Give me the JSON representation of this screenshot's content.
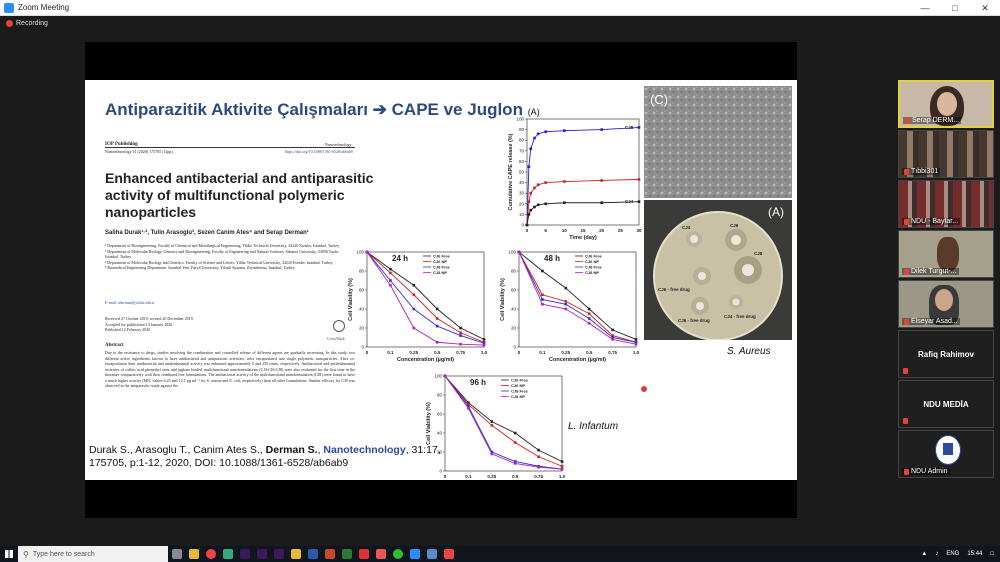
{
  "window": {
    "title": "Zoom Meeting"
  },
  "recording": {
    "label": "Recording"
  },
  "slide": {
    "title": "Antiparazitik Aktivite Çalışmaları ➔ CAPE ve Juglon",
    "title_marker": "(A)",
    "publisher": "IOP Publishing",
    "journal_right": "Nanotechnology",
    "journal_line": "Nanotechnology 31 (2020) 175705 (12pp)",
    "doi_line": "https://doi.org/10.1088/1361-6528/ab6ab9",
    "paper_title": "Enhanced antibacterial and antiparasitic activity of multifunctional polymeric nanoparticles",
    "authors": "Saliha Durak¹·², Tulin Arasoglu³, Sezen Canim Ates⁴ and Serap Derman¹",
    "affiliations": [
      "¹ Department of Bioengineering, Faculty of Chemical and Metallurgical Engineering, Yildiz Technical University, 34220 Esenler, Istanbul, Turkey",
      "² Department of Molecular Biology, Genetics and Bioengineering, Faculty of Engineering and Natural Sciences, Sabanci University, 34956 Tuzla, Istanbul, Turkey",
      "³ Department of Molecular Biology and Genetics, Faculty of Science and Letters, Yildiz Technical University, 34220 Esenler, Istanbul, Turkey",
      "⁴ Biomedical Engineering Department, Istanbul Yeni Yuzyil University, Yilanli Ayazma, Zeytinburnu, Istanbul, Turkey"
    ],
    "email": "E-mail: sderman@yildiz.edu.tr",
    "dates": [
      "Received 27 October 2019, revised 20 December 2019",
      "Accepted for publication 13 January 2020",
      "Published 12 February 2020"
    ],
    "crossmark": "CrossMark",
    "abstract_head": "Abstract",
    "abstract": "Due to the resistance to drugs, studies involving the combination and controlled release of different agents are gradually increasing. In this study, two different active ingredients, known to have antibacterial and antiparasitic activities, were encapsulated into single polymeric nanoparticles. After co-encapsulation their antibacterial and antileishmanial activity was enhanced approximately 5 and 250 times, respectively. Antibacterial and antileishmanial activities of caffeic acid phenethyl ester and juglone loaded, multifunctional nanoformulations (CJ4-CJ6-CJ8) were also evaluated for the first time in the literature comparatively with their combined free formulations. The antibacterial activity of the multifunctional nanoformulation (CJ8) were found to have a much higher activity (MIC values 6.25 and 12.5 µg ml⁻¹ for S. aureus and E. coli, respectively) than all other formulations. Similar efficacy for CJ8 was observed in the antiparasitic study against the",
    "citation": {
      "pre": "Durak S., Arasoglu T., Canim Ates S., ",
      "bold": "Derman S.",
      "mid": ", ",
      "journal": "Nanotechnology",
      "post": ", 31:17, 175705, p:1-12, 2020, DOI: 10.1088/1361-6528/ab6ab9"
    },
    "label_c": "(C)",
    "label_a": "(A)",
    "s_aureus": "S. Aureus",
    "l_infantum": "L. Infantum",
    "plate_labels": [
      {
        "text": "CJ4"
      },
      {
        "text": "CJ6"
      },
      {
        "text": "CJ8"
      },
      {
        "text": "CJ6 - free drug"
      },
      {
        "text": "CJ6 - free drug"
      },
      {
        "text": "CJ4 - free drug"
      }
    ]
  },
  "chart_data": [
    {
      "type": "line",
      "title": "",
      "xlabel": "Time (day)",
      "ylabel": "Cumulative CAPE release (%)",
      "x": [
        0,
        0.5,
        1,
        2,
        3,
        5,
        10,
        20,
        30
      ],
      "xticks": [
        0,
        5,
        10,
        15,
        20,
        25,
        30
      ],
      "yticks": [
        0,
        10,
        20,
        30,
        40,
        50,
        60,
        70,
        80,
        90,
        100
      ],
      "xlim": [
        0,
        30
      ],
      "ylim": [
        0,
        100
      ],
      "series": [
        {
          "name": "CJ8",
          "color": "#2020d0",
          "values": [
            0,
            55,
            72,
            82,
            86,
            88,
            89,
            90,
            92
          ]
        },
        {
          "name": "",
          "color": "#d02020",
          "values": [
            0,
            22,
            30,
            35,
            38,
            40,
            41,
            42,
            43
          ]
        },
        {
          "name": "CJ4",
          "color": "#202020",
          "values": [
            0,
            10,
            14,
            17,
            19,
            20,
            21,
            21,
            22
          ]
        }
      ]
    },
    {
      "type": "line",
      "title": "24 h",
      "xlabel": "Concentration (µg/ml)",
      "ylabel": "Cell Viability (%)",
      "categories": [
        "0",
        "0.1",
        "0.25",
        "0.5",
        "0.75",
        "1.0"
      ],
      "ylim": [
        0,
        100
      ],
      "yticks": [
        0,
        20,
        40,
        60,
        80,
        100
      ],
      "series": [
        {
          "name": "CJ6 Free",
          "color": "#222222",
          "values": [
            100,
            82,
            65,
            40,
            20,
            8
          ]
        },
        {
          "name": "CJ6 NP",
          "color": "#d02020",
          "values": [
            100,
            78,
            55,
            30,
            15,
            5
          ]
        },
        {
          "name": "CJ8 Free",
          "color": "#3030d0",
          "values": [
            100,
            70,
            40,
            22,
            12,
            4
          ]
        },
        {
          "name": "CJ8 NP",
          "color": "#b020c0",
          "values": [
            100,
            65,
            20,
            5,
            3,
            2
          ]
        }
      ]
    },
    {
      "type": "line",
      "title": "48 h",
      "xlabel": "Concentration (µg/ml)",
      "ylabel": "Cell Viability (%)",
      "categories": [
        "0",
        "0.1",
        "0.25",
        "0.5",
        "0.75",
        "1.0"
      ],
      "ylim": [
        0,
        100
      ],
      "yticks": [
        0,
        20,
        40,
        60,
        80,
        100
      ],
      "series": [
        {
          "name": "CJ6 Free",
          "color": "#222222",
          "values": [
            100,
            80,
            62,
            40,
            18,
            8
          ]
        },
        {
          "name": "CJ6 NP",
          "color": "#d02020",
          "values": [
            100,
            55,
            48,
            35,
            12,
            5
          ]
        },
        {
          "name": "CJ8 Free",
          "color": "#3030d0",
          "values": [
            100,
            50,
            45,
            30,
            10,
            5
          ]
        },
        {
          "name": "CJ8 NP",
          "color": "#b020c0",
          "values": [
            100,
            45,
            40,
            25,
            8,
            3
          ]
        }
      ]
    },
    {
      "type": "line",
      "title": "96 h",
      "xlabel": "Concentration (µg/ml)",
      "ylabel": "Cell Viability (%)",
      "categories": [
        "0",
        "0.1",
        "0.25",
        "0.5",
        "0.75",
        "1.0"
      ],
      "ylim": [
        0,
        100
      ],
      "yticks": [
        0,
        20,
        40,
        60,
        80,
        100
      ],
      "series": [
        {
          "name": "CJ6 Free",
          "color": "#222222",
          "values": [
            100,
            72,
            52,
            40,
            22,
            10
          ]
        },
        {
          "name": "CJ6 NP",
          "color": "#d02020",
          "values": [
            100,
            70,
            48,
            30,
            15,
            5
          ]
        },
        {
          "name": "CJ8 Free",
          "color": "#3030d0",
          "values": [
            100,
            68,
            20,
            10,
            5,
            2
          ]
        },
        {
          "name": "CJ8 NP",
          "color": "#b020c0",
          "values": [
            100,
            66,
            18,
            8,
            4,
            2
          ]
        }
      ]
    }
  ],
  "participants": [
    {
      "name": "Serap DERM..."
    },
    {
      "name": "Tıbbi301"
    },
    {
      "name": "NDU - Baytar..."
    },
    {
      "name": "Dilek Turgut-..."
    },
    {
      "name": "Elseyar Asad..."
    },
    {
      "name": "Rafiq Rahimov"
    },
    {
      "name": "NDU MEDİA"
    },
    {
      "name": "NDU Admin"
    }
  ],
  "taskbar": {
    "search_placeholder": "Type here to search",
    "lang": "ENG",
    "time": "15:44"
  }
}
